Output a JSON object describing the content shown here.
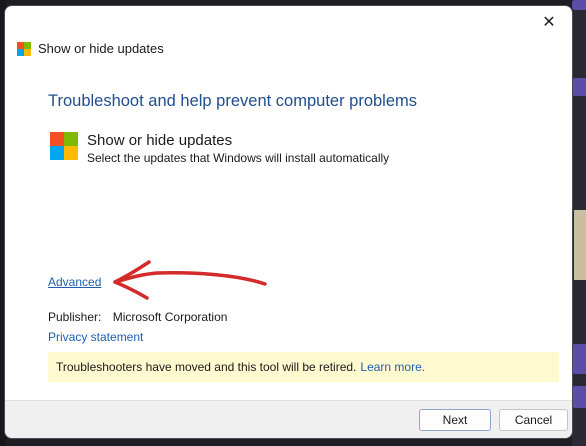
{
  "window": {
    "title": "Show or hide updates",
    "close_glyph": "✕",
    "title_icon": "windows-logo-icon"
  },
  "main": {
    "heading": "Troubleshoot and help prevent computer problems",
    "tool": {
      "title": "Show or hide updates",
      "description": "Select the updates that Windows will install automatically",
      "icon": "windows-logo-icon"
    },
    "advanced_link": "Advanced",
    "publisher": {
      "label": "Publisher:",
      "value": "Microsoft Corporation"
    },
    "privacy_link": "Privacy statement",
    "notice": {
      "text": "Troubleshooters have moved and this tool will be retired.",
      "link": "Learn more."
    }
  },
  "footer": {
    "next_label": "Next",
    "cancel_label": "Cancel"
  },
  "colors": {
    "heading": "#1f4e8c",
    "link": "#1f5fad",
    "notice_bg": "#fff9cf",
    "annotation": "#d42a2a"
  }
}
